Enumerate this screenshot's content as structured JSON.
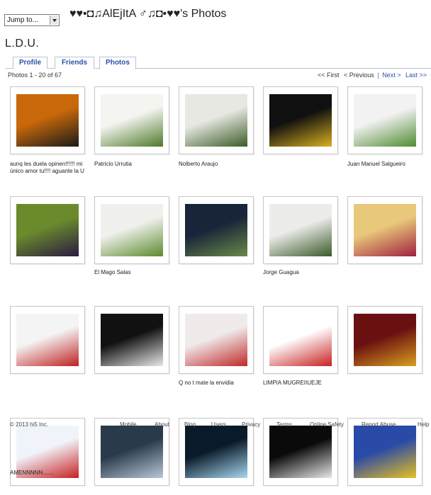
{
  "header": {
    "jump_label": "Jump to...",
    "title": "♥♥•◘♫AlEjItA ♂♫◘•♥♥'s Photos",
    "user_name": "L.D.U."
  },
  "tabs": [
    {
      "label": "Profile"
    },
    {
      "label": "Friends"
    },
    {
      "label": "Photos"
    }
  ],
  "album": {
    "count_text": "Photos 1 - 20 of 67",
    "first": "<< First",
    "previous": "< Previous",
    "next": "Next >",
    "last": "Last >>"
  },
  "photos": [
    {
      "caption": "aunq les duela opinen!!!!!! mi único amor tu!!!! aguante la U",
      "colors": [
        "#c8680a",
        "#1a1a1a"
      ]
    },
    {
      "caption": "Patricio Urrutia",
      "colors": [
        "#f4f4f0",
        "#4d7a2a"
      ]
    },
    {
      "caption": "Nolberto Araujo",
      "colors": [
        "#e8e8e2",
        "#3b5c28"
      ]
    },
    {
      "caption": "",
      "colors": [
        "#101010",
        "#d8b020"
      ]
    },
    {
      "caption": "Juan Manuel Salgueiro",
      "colors": [
        "#f2f2f2",
        "#4f8a30"
      ]
    },
    {
      "caption": "",
      "colors": [
        "#6a8a2c",
        "#2a1a40"
      ]
    },
    {
      "caption": "El Mago Salas",
      "colors": [
        "#f0f0ec",
        "#5a8a2c"
      ]
    },
    {
      "caption": "",
      "colors": [
        "#18243a",
        "#6a8a48"
      ]
    },
    {
      "caption": "Jorge Guagua",
      "colors": [
        "#ececea",
        "#3a5a2a"
      ]
    },
    {
      "caption": "",
      "colors": [
        "#e8c87a",
        "#a02040"
      ]
    },
    {
      "caption": "",
      "colors": [
        "#f4f4f4",
        "#c02020"
      ]
    },
    {
      "caption": "",
      "colors": [
        "#111111",
        "#e8e8e8"
      ]
    },
    {
      "caption": "Q no t mate la envidia",
      "colors": [
        "#f0eaea",
        "#c02828"
      ]
    },
    {
      "caption": "LIMPIA MUGREIIUEJE",
      "colors": [
        "#ffffff",
        "#c82020"
      ]
    },
    {
      "caption": "",
      "colors": [
        "#6a1010",
        "#d8a020"
      ]
    },
    {
      "caption": "AMENNNNN.......",
      "colors": [
        "#f0f4fa",
        "#c82020"
      ]
    },
    {
      "caption": "",
      "colors": [
        "#2a3a4a",
        "#b8c8d8"
      ]
    },
    {
      "caption": "",
      "colors": [
        "#0a1a2a",
        "#a8d8f0"
      ]
    },
    {
      "caption": "",
      "colors": [
        "#0a0a0a",
        "#e8e8e8"
      ]
    },
    {
      "caption": "",
      "colors": [
        "#2a4aa8",
        "#e8c020"
      ]
    }
  ],
  "footer": {
    "copyright": "© 2013 hi5 Inc.",
    "links": [
      "Mobile",
      "About",
      "Blog",
      "Users",
      "Privacy",
      "Terms",
      "Online Safety",
      "Report Abuse",
      "Help"
    ]
  }
}
